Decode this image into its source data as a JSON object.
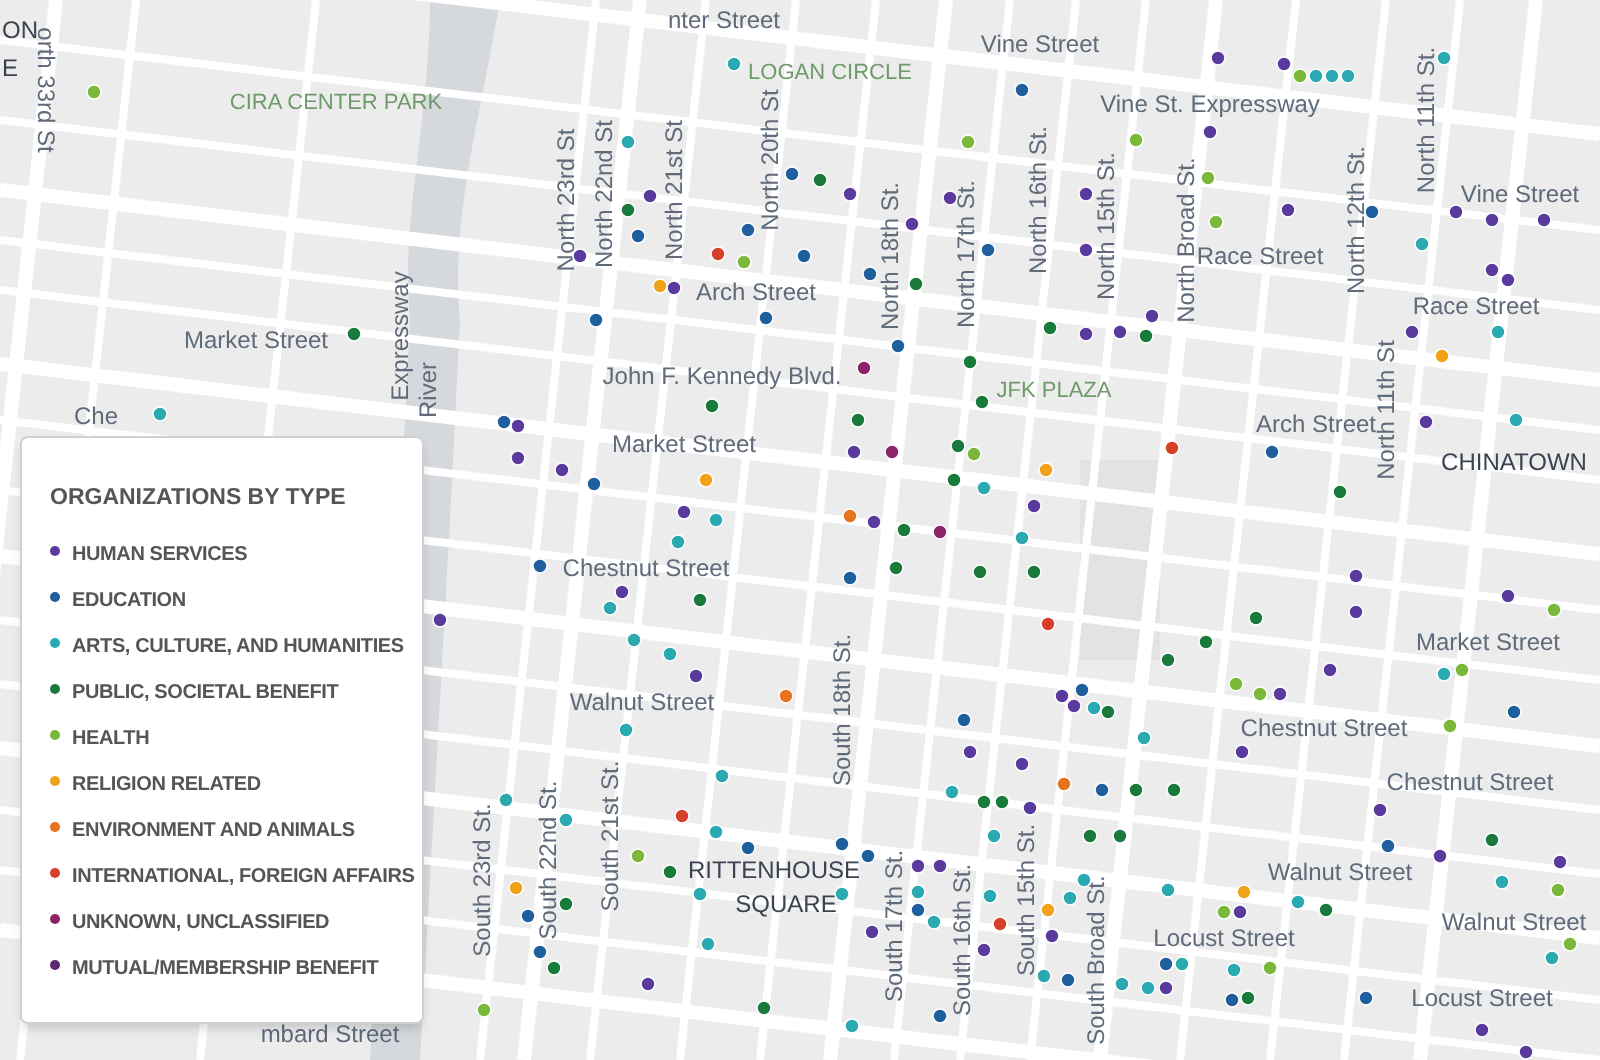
{
  "map": {
    "labels": [
      {
        "text": "nter Street",
        "kind": "street"
      },
      {
        "text": "Vine Street",
        "kind": "street"
      },
      {
        "text": "Vine St. Expressway",
        "kind": "street"
      },
      {
        "text": "Vine Street",
        "kind": "street"
      },
      {
        "text": "Race Street",
        "kind": "street"
      },
      {
        "text": "Race Street",
        "kind": "street"
      },
      {
        "text": "Arch Street",
        "kind": "street"
      },
      {
        "text": "Arch Street",
        "kind": "street"
      },
      {
        "text": "Market Street",
        "kind": "street"
      },
      {
        "text": "John F. Kennedy Blvd.",
        "kind": "street"
      },
      {
        "text": "Market Street",
        "kind": "street"
      },
      {
        "text": "Chestnut Street",
        "kind": "street"
      },
      {
        "text": "Walnut Street",
        "kind": "street"
      },
      {
        "text": "Market Street",
        "kind": "street"
      },
      {
        "text": "Chestnut Street",
        "kind": "street"
      },
      {
        "text": "Chestnut Street",
        "kind": "street"
      },
      {
        "text": "Walnut Street",
        "kind": "street"
      },
      {
        "text": "Walnut Street",
        "kind": "street"
      },
      {
        "text": "Locust Street",
        "kind": "street"
      },
      {
        "text": "Locust Street",
        "kind": "street"
      },
      {
        "text": "mbard Street",
        "kind": "street"
      },
      {
        "text": "Che",
        "kind": "street"
      },
      {
        "text": "orth 33rd St",
        "kind": "street"
      },
      {
        "text": "North 23rd St",
        "kind": "street"
      },
      {
        "text": "North 22nd St",
        "kind": "street"
      },
      {
        "text": "North 21st St",
        "kind": "street"
      },
      {
        "text": "North 20th St",
        "kind": "street"
      },
      {
        "text": "North 18th St.",
        "kind": "street"
      },
      {
        "text": "North 17th St.",
        "kind": "street"
      },
      {
        "text": "North 16th St.",
        "kind": "street"
      },
      {
        "text": "North 15th St.",
        "kind": "street"
      },
      {
        "text": "North Broad St.",
        "kind": "street"
      },
      {
        "text": "North 12th St.",
        "kind": "street"
      },
      {
        "text": "North 11th St.",
        "kind": "street"
      },
      {
        "text": "North 11th St",
        "kind": "street"
      },
      {
        "text": "South 23rd St.",
        "kind": "street"
      },
      {
        "text": "South 22nd St.",
        "kind": "street"
      },
      {
        "text": "South 21st St.",
        "kind": "street"
      },
      {
        "text": "South 18th St.",
        "kind": "street"
      },
      {
        "text": "South 17th St.",
        "kind": "street"
      },
      {
        "text": "South 16th St.",
        "kind": "street"
      },
      {
        "text": "South 15th St.",
        "kind": "street"
      },
      {
        "text": "South Broad St.",
        "kind": "street"
      },
      {
        "text": "Expressway",
        "kind": "street"
      },
      {
        "text": "River",
        "kind": "street"
      },
      {
        "text": "CIRA CENTER PARK",
        "kind": "park"
      },
      {
        "text": "LOGAN CIRCLE",
        "kind": "park"
      },
      {
        "text": "JFK PLAZA",
        "kind": "park"
      },
      {
        "text": "CHINATOWN",
        "kind": "place"
      },
      {
        "text": "RITTENHOUSE",
        "kind": "place"
      },
      {
        "text": "SQUARE",
        "kind": "place"
      },
      {
        "text": "ON",
        "kind": "place"
      },
      {
        "text": "E",
        "kind": "place"
      }
    ],
    "pins": [
      {
        "color": "#7ab83a"
      },
      {
        "color": "#2aa9b0"
      },
      {
        "color": "#2aa9b0"
      },
      {
        "color": "#5b3a9e"
      },
      {
        "color": "#1a7a3c"
      },
      {
        "color": "#1f5f9e"
      },
      {
        "color": "#1f5f9e"
      },
      {
        "color": "#1f5f9e"
      },
      {
        "color": "#5b3a9e"
      },
      {
        "color": "#d6402a"
      },
      {
        "color": "#7ab83a"
      },
      {
        "color": "#f0a21a"
      },
      {
        "color": "#5b3a9e"
      },
      {
        "color": "#1f5f9e"
      },
      {
        "color": "#1f5f9e"
      },
      {
        "color": "#1a7a3c"
      },
      {
        "color": "#1a7a3c"
      },
      {
        "color": "#1f5f9e"
      },
      {
        "color": "#5b3a9e"
      },
      {
        "color": "#2aa9b0"
      },
      {
        "color": "#5b3a9e"
      },
      {
        "color": "#5b3a9e"
      },
      {
        "color": "#7ab83a"
      },
      {
        "color": "#2aa9b0"
      },
      {
        "color": "#2aa9b0"
      },
      {
        "color": "#2aa9b0"
      },
      {
        "color": "#2aa9b0"
      },
      {
        "color": "#1f5f9e"
      },
      {
        "color": "#5b3a9e"
      },
      {
        "color": "#7ab83a"
      },
      {
        "color": "#7ab83a"
      },
      {
        "color": "#1a7a3c"
      },
      {
        "color": "#5b3a9e"
      },
      {
        "color": "#5b3a9e"
      },
      {
        "color": "#5b3a9e"
      },
      {
        "color": "#7ab83a"
      },
      {
        "color": "#5b3a9e"
      },
      {
        "color": "#1f5f9e"
      },
      {
        "color": "#5b3a9e"
      },
      {
        "color": "#7ab83a"
      },
      {
        "color": "#5b3a9e"
      },
      {
        "color": "#1f5f9e"
      },
      {
        "color": "#2aa9b0"
      },
      {
        "color": "#5b3a9e"
      },
      {
        "color": "#5b3a9e"
      },
      {
        "color": "#5b3a9e"
      },
      {
        "color": "#1f5f9e"
      },
      {
        "color": "#1f5f9e"
      },
      {
        "color": "#1a7a3c"
      },
      {
        "color": "#2aa9b0"
      },
      {
        "color": "#5b3a9e"
      },
      {
        "color": "#5b3a9e"
      },
      {
        "color": "#5b3a9e"
      },
      {
        "color": "#1a7a3c"
      },
      {
        "color": "#5b3a9e"
      },
      {
        "color": "#1a7a3c"
      },
      {
        "color": "#1f5f9e"
      },
      {
        "color": "#5b3a9e"
      },
      {
        "color": "#5b3a9e"
      },
      {
        "color": "#f0a21a"
      },
      {
        "color": "#8e2468"
      },
      {
        "color": "#1a7a3c"
      },
      {
        "color": "#1a7a3c"
      },
      {
        "color": "#1a7a3c"
      },
      {
        "color": "#5b3a9e"
      },
      {
        "color": "#5b3a9e"
      },
      {
        "color": "#8e2468"
      },
      {
        "color": "#1a7a3c"
      },
      {
        "color": "#7ab83a"
      },
      {
        "color": "#1a7a3c"
      },
      {
        "color": "#2aa9b0"
      },
      {
        "color": "#f0a21a"
      },
      {
        "color": "#5b3a9e"
      },
      {
        "color": "#e8731e"
      },
      {
        "color": "#5b3a9e"
      },
      {
        "color": "#1a7a3c"
      },
      {
        "color": "#8e2468"
      },
      {
        "color": "#2aa9b0"
      },
      {
        "color": "#1f5f9e"
      },
      {
        "color": "#1a7a3c"
      },
      {
        "color": "#1a7a3c"
      },
      {
        "color": "#1a7a3c"
      },
      {
        "color": "#d6402a"
      },
      {
        "color": "#d6402a"
      },
      {
        "color": "#1f5f9e"
      },
      {
        "color": "#1a7a3c"
      },
      {
        "color": "#2aa9b0"
      },
      {
        "color": "#5b3a9e"
      },
      {
        "color": "#5b3a9e"
      },
      {
        "color": "#5b3a9e"
      },
      {
        "color": "#1a7a3c"
      },
      {
        "color": "#1a7a3c"
      },
      {
        "color": "#1a7a3c"
      },
      {
        "color": "#7ab83a"
      },
      {
        "color": "#7ab83a"
      },
      {
        "color": "#5b3a9e"
      },
      {
        "color": "#5b3a9e"
      },
      {
        "color": "#2aa9b0"
      },
      {
        "color": "#7ab83a"
      },
      {
        "color": "#7ab83a"
      },
      {
        "color": "#1f5f9e"
      },
      {
        "color": "#7ab83a"
      },
      {
        "color": "#5b3a9e"
      },
      {
        "color": "#5b3a9e"
      },
      {
        "color": "#1a7a3c"
      },
      {
        "color": "#1f5f9e"
      },
      {
        "color": "#5b3a9e"
      },
      {
        "color": "#5b3a9e"
      },
      {
        "color": "#2aa9b0"
      },
      {
        "color": "#5b3a9e"
      },
      {
        "color": "#5b3a9e"
      },
      {
        "color": "#1f5f9e"
      },
      {
        "color": "#2aa9b0"
      },
      {
        "color": "#1a7a3c"
      },
      {
        "color": "#2aa9b0"
      },
      {
        "color": "#1f5f9e"
      },
      {
        "color": "#5b3a9e"
      },
      {
        "color": "#5b3a9e"
      },
      {
        "color": "#e8731e"
      },
      {
        "color": "#1f5f9e"
      },
      {
        "color": "#1a7a3c"
      },
      {
        "color": "#1a7a3c"
      },
      {
        "color": "#2aa9b0"
      },
      {
        "color": "#1a7a3c"
      },
      {
        "color": "#1a7a3c"
      },
      {
        "color": "#5b3a9e"
      },
      {
        "color": "#1a7a3c"
      },
      {
        "color": "#1a7a3c"
      },
      {
        "color": "#2aa9b0"
      },
      {
        "color": "#2aa9b0"
      },
      {
        "color": "#1f5f9e"
      },
      {
        "color": "#5b3a9e"
      },
      {
        "color": "#5b3a9e"
      },
      {
        "color": "#1f5f9e"
      },
      {
        "color": "#2aa9b0"
      },
      {
        "color": "#2aa9b0"
      },
      {
        "color": "#1f5f9e"
      },
      {
        "color": "#2aa9b0"
      },
      {
        "color": "#d6402a"
      },
      {
        "color": "#f0a21a"
      },
      {
        "color": "#2aa9b0"
      },
      {
        "color": "#5b3a9e"
      },
      {
        "color": "#5b3a9e"
      },
      {
        "color": "#5b3a9e"
      },
      {
        "color": "#2aa9b0"
      },
      {
        "color": "#2aa9b0"
      },
      {
        "color": "#f0a21a"
      },
      {
        "color": "#7ab83a"
      },
      {
        "color": "#5b3a9e"
      },
      {
        "color": "#2aa9b0"
      },
      {
        "color": "#1a7a3c"
      },
      {
        "color": "#1f5f9e"
      },
      {
        "color": "#2aa9b0"
      },
      {
        "color": "#2aa9b0"
      },
      {
        "color": "#7ab83a"
      },
      {
        "color": "#2aa9b0"
      },
      {
        "color": "#1f5f9e"
      },
      {
        "color": "#2aa9b0"
      },
      {
        "color": "#2aa9b0"
      },
      {
        "color": "#5b3a9e"
      },
      {
        "color": "#1f5f9e"
      },
      {
        "color": "#1a7a3c"
      },
      {
        "color": "#1f5f9e"
      },
      {
        "color": "#5b3a9e"
      },
      {
        "color": "#5b3a9e"
      },
      {
        "color": "#7ab83a"
      },
      {
        "color": "#7ab83a"
      },
      {
        "color": "#2aa9b0"
      },
      {
        "color": "#2aa9b0"
      },
      {
        "color": "#1f5f9e"
      },
      {
        "color": "#5b3a9e"
      },
      {
        "color": "#5b3a9e"
      },
      {
        "color": "#1f5f9e"
      },
      {
        "color": "#f0a21a"
      },
      {
        "color": "#5b3a9e"
      },
      {
        "color": "#2aa9b0"
      },
      {
        "color": "#1f5f9e"
      },
      {
        "color": "#2aa9b0"
      },
      {
        "color": "#5b3a9e"
      },
      {
        "color": "#2aa9b0"
      },
      {
        "color": "#1a7a3c"
      },
      {
        "color": "#5b3a9e"
      },
      {
        "color": "#2aa9b0"
      },
      {
        "color": "#2aa9b0"
      },
      {
        "color": "#5b3a9e"
      },
      {
        "color": "#e8731e"
      },
      {
        "color": "#2aa9b0"
      },
      {
        "color": "#2aa9b0"
      },
      {
        "color": "#2aa9b0"
      },
      {
        "color": "#2aa9b0"
      },
      {
        "color": "#d6402a"
      },
      {
        "color": "#2aa9b0"
      },
      {
        "color": "#7ab83a"
      },
      {
        "color": "#1a7a3c"
      },
      {
        "color": "#1f5f9e"
      },
      {
        "color": "#f0a21a"
      },
      {
        "color": "#1f5f9e"
      },
      {
        "color": "#1a7a3c"
      },
      {
        "color": "#2aa9b0"
      },
      {
        "color": "#1f5f9e"
      },
      {
        "color": "#2aa9b0"
      },
      {
        "color": "#1a7a3c"
      },
      {
        "color": "#5b3a9e"
      },
      {
        "color": "#7ab83a"
      },
      {
        "color": "#1a7a3c"
      }
    ]
  },
  "legend": {
    "title": "ORGANIZATIONS BY TYPE",
    "items": [
      {
        "label": "HUMAN SERVICES",
        "color": "#5b3a9e"
      },
      {
        "label": "EDUCATION",
        "color": "#1f5f9e"
      },
      {
        "label": "ARTS, CULTURE, AND HUMANITIES",
        "color": "#2aa9b0"
      },
      {
        "label": "PUBLIC, SOCIETAL BENEFIT",
        "color": "#1a7a3c"
      },
      {
        "label": "HEALTH",
        "color": "#7ab83a"
      },
      {
        "label": "RELIGION RELATED",
        "color": "#f0a21a"
      },
      {
        "label": "ENVIRONMENT AND ANIMALS",
        "color": "#e8731e"
      },
      {
        "label": "INTERNATIONAL, FOREIGN AFFAIRS",
        "color": "#d6402a"
      },
      {
        "label": "UNKNOWN, UNCLASSIFIED",
        "color": "#8e2468"
      },
      {
        "label": "MUTUAL/MEMBERSHIP BENEFIT",
        "color": "#5b2a6e"
      }
    ]
  }
}
